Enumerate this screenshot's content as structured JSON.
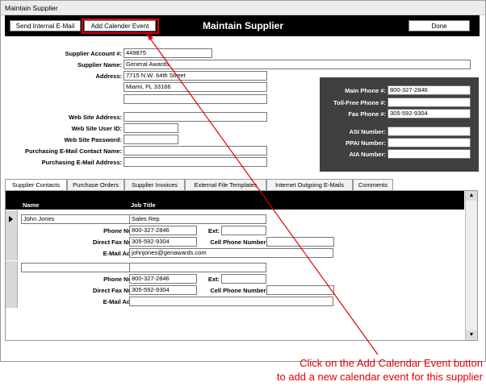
{
  "window": {
    "title": "Maintain Supplier"
  },
  "header": {
    "send_email_label": "Send Internal E-Mail",
    "add_calendar_label": "Add Calender Event",
    "title": "Maintain Supplier",
    "done_label": "Done"
  },
  "supplier": {
    "account_label": "Supplier Account #:",
    "account_value": "449875",
    "name_label": "Supplier Name:",
    "name_value": "General Awards",
    "address_label": "Address:",
    "address_line1": "7715 N.W. 64th Street",
    "address_line2": "Miami, FL  33166",
    "address_line3": "",
    "website_label": "Web Site Address:",
    "website_value": "",
    "website_user_label": "Web Site User ID:",
    "website_user_value": "",
    "website_pw_label": "Web Site Password:",
    "website_pw_value": "",
    "purchasing_contact_label": "Purchasing E-Mail Contact Name:",
    "purchasing_contact_value": "",
    "purchasing_email_label": "Purchasing E-Mail Address:",
    "purchasing_email_value": ""
  },
  "phones": {
    "main_label": "Main Phone #:",
    "main_value": "800-327-2846",
    "tollfree_label": "Toll-Free Phone #:",
    "tollfree_value": "",
    "fax_label": "Fax Phone #:",
    "fax_value": "305-592-9304",
    "asi_label": "ASI Number:",
    "asi_value": "",
    "ppai_label": "PPAI Number:",
    "ppai_value": "",
    "aia_label": "AIA Number:",
    "aia_value": ""
  },
  "tabs": [
    {
      "label": "Supplier Contacts"
    },
    {
      "label": "Purchase Orders"
    },
    {
      "label": "Supplier Invoices"
    },
    {
      "label": "External File Templates"
    },
    {
      "label": "Internet Outgoing E-Mails"
    },
    {
      "label": "Comments"
    }
  ],
  "contacts_header": {
    "name": "Name",
    "job_title": "Job Title"
  },
  "contact_labels": {
    "phone": "Phone Number:",
    "ext": "Ext:",
    "fax": "Direct Fax Number:",
    "cell": "Cell Phone Number:",
    "email": "E-Mail Address:"
  },
  "contacts": [
    {
      "name": "John Jones",
      "job_title": "Sales Rep",
      "phone": "800-327-2846",
      "ext": "",
      "fax": "305-592-9304",
      "cell": "",
      "email": "johnjones@genawards.com"
    },
    {
      "name": "",
      "job_title": "",
      "phone": "800-327-2846",
      "ext": "",
      "fax": "305-592-9304",
      "cell": "",
      "email": ""
    }
  ],
  "record_selector": {
    "current_icon": "record-pointer-icon"
  },
  "scrollbar": {
    "up_icon": "scroll-up-icon",
    "down_icon": "scroll-down-icon"
  },
  "annotation": {
    "line1": "Click on the Add Calendar Event button",
    "line2": "to add a new calendar event for this supplier",
    "color": "#e00000"
  }
}
